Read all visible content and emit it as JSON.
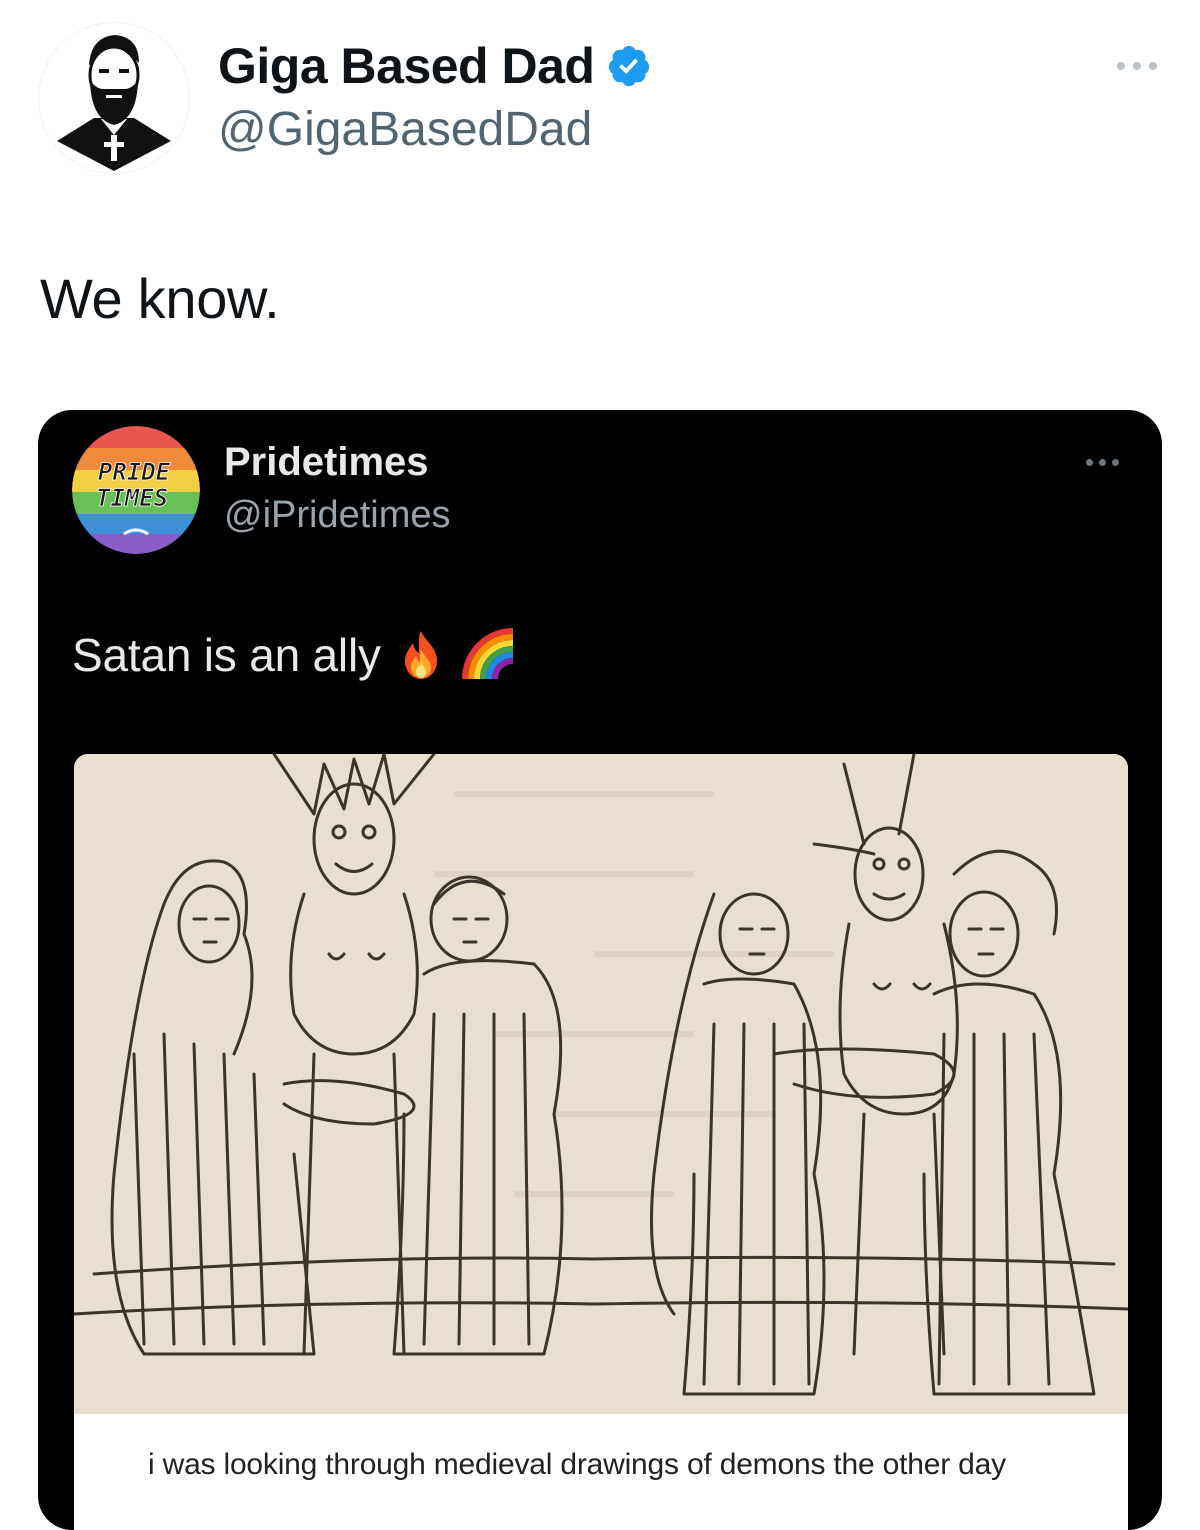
{
  "tweet": {
    "author": {
      "display_name": "Giga Based Dad",
      "handle": "@GigaBasedDad",
      "verified": true,
      "avatar_icon": "bearded-man-with-cross-avatar"
    },
    "text": "We know.",
    "more_icon": "more-horizontal-icon"
  },
  "quoted_tweet": {
    "author": {
      "display_name": "Pridetimes",
      "handle": "@iPridetimes",
      "avatar_text": "PRIDE TIMES",
      "avatar_icon": "rainbow-circle-logo"
    },
    "text": "Satan is an ally",
    "emojis": [
      "fire-emoji",
      "rainbow-emoji"
    ],
    "media": {
      "image": "medieval-woodcut-demons-drawing",
      "caption": "i was looking through medieval drawings of demons the other day"
    },
    "more_icon": "more-horizontal-icon"
  },
  "colors": {
    "verified_blue": "#1d9bf0",
    "text_primary": "#0f1419",
    "text_secondary": "#536471",
    "quote_background": "#000000",
    "paper": "#e9e0d3"
  }
}
